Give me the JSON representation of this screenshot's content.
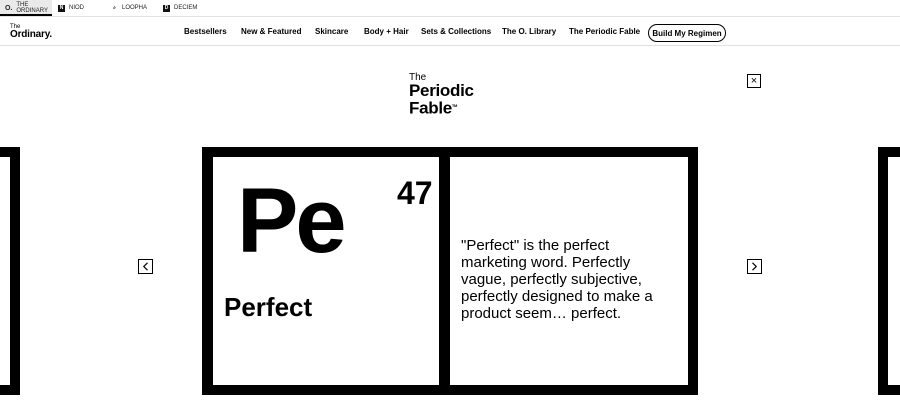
{
  "brands": [
    {
      "mark": "O.",
      "label_line1": "THE",
      "label_line2": "ORDINARY"
    },
    {
      "mark": "N",
      "label": "NIOD"
    },
    {
      "mark": "⌕",
      "label": "LOOPHA"
    },
    {
      "mark": "D",
      "label": "DECIEM"
    }
  ],
  "logo": {
    "small": "The",
    "big": "Ordinary."
  },
  "nav": {
    "items": [
      "Bestsellers",
      "New & Featured",
      "Skincare",
      "Body + Hair",
      "Sets & Collections",
      "The O. Library",
      "The Periodic Fable"
    ],
    "cta": "Build My Regimen"
  },
  "fable_logo": {
    "line1": "The",
    "line2": "Periodic",
    "line3": "Fable",
    "tm": "TM"
  },
  "close_glyph": "×",
  "element": {
    "symbol": "Pe",
    "number": "47",
    "name": "Perfect",
    "description": "\"Perfect\" is the perfect marketing word. Perfectly vague, perfectly subjective, perfectly designed to make a product seem… perfect."
  },
  "icons": {
    "prev": "chevron-left-icon",
    "next": "chevron-right-icon",
    "close": "close-icon"
  }
}
